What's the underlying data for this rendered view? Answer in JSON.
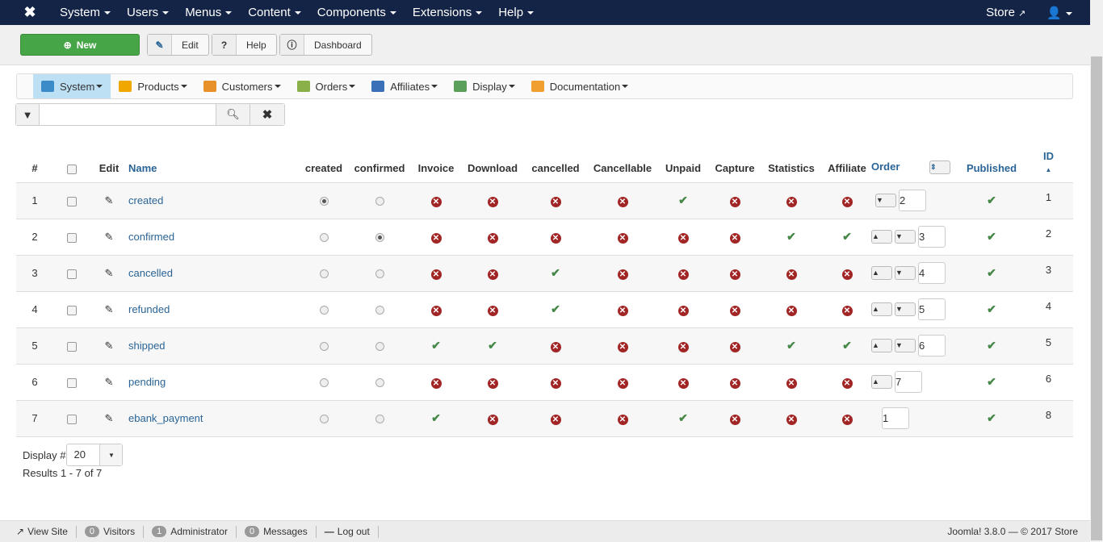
{
  "topnav": {
    "items": [
      "System",
      "Users",
      "Menus",
      "Content",
      "Components",
      "Extensions",
      "Help"
    ],
    "store": "Store"
  },
  "toolbar": {
    "new": "New",
    "edit": "Edit",
    "help": "Help",
    "dashboard": "Dashboard"
  },
  "submenu": [
    {
      "label": "System",
      "color": "#3b8bc9"
    },
    {
      "label": "Products",
      "color": "#f0a800"
    },
    {
      "label": "Customers",
      "color": "#e8902a"
    },
    {
      "label": "Orders",
      "color": "#8ab04a"
    },
    {
      "label": "Affiliates",
      "color": "#3a70b8"
    },
    {
      "label": "Display",
      "color": "#5aa05a"
    },
    {
      "label": "Documentation",
      "color": "#f0a030"
    }
  ],
  "search": {
    "value": "",
    "placeholder": ""
  },
  "table": {
    "headers": [
      "#",
      "Edit",
      "Name",
      "created",
      "confirmed",
      "Invoice",
      "Download",
      "cancelled",
      "Cancellable",
      "Unpaid",
      "Capture",
      "Statistics",
      "Affiliate",
      "Order",
      "Published",
      "ID"
    ],
    "rows": [
      {
        "num": "1",
        "name": "created",
        "radio": "created",
        "flags": [
          "x",
          "x",
          "x",
          "x",
          "v",
          "x",
          "x",
          "x"
        ],
        "up": false,
        "down": true,
        "order": "2",
        "published": "v",
        "id": "1"
      },
      {
        "num": "2",
        "name": "confirmed",
        "radio": "confirmed",
        "flags": [
          "x",
          "x",
          "x",
          "x",
          "x",
          "x",
          "v",
          "v"
        ],
        "up": true,
        "down": true,
        "order": "3",
        "published": "v",
        "id": "2"
      },
      {
        "num": "3",
        "name": "cancelled",
        "radio": "",
        "flags": [
          "x",
          "x",
          "v",
          "x",
          "x",
          "x",
          "x",
          "x"
        ],
        "up": true,
        "down": true,
        "order": "4",
        "published": "v",
        "id": "3"
      },
      {
        "num": "4",
        "name": "refunded",
        "radio": "",
        "flags": [
          "x",
          "x",
          "v",
          "x",
          "x",
          "x",
          "x",
          "x"
        ],
        "up": true,
        "down": true,
        "order": "5",
        "published": "v",
        "id": "4"
      },
      {
        "num": "5",
        "name": "shipped",
        "radio": "",
        "flags": [
          "v",
          "v",
          "x",
          "x",
          "x",
          "x",
          "v",
          "v"
        ],
        "up": true,
        "down": true,
        "order": "6",
        "published": "v",
        "id": "5"
      },
      {
        "num": "6",
        "name": "pending",
        "radio": "",
        "flags": [
          "x",
          "x",
          "x",
          "x",
          "x",
          "x",
          "x",
          "x"
        ],
        "up": true,
        "down": false,
        "order": "7",
        "published": "v",
        "id": "6"
      },
      {
        "num": "7",
        "name": "ebank_payment",
        "radio": "",
        "flags": [
          "v",
          "x",
          "x",
          "x",
          "v",
          "x",
          "x",
          "x"
        ],
        "up": false,
        "down": false,
        "order": "1",
        "published": "v",
        "id": "8"
      }
    ]
  },
  "pagination": {
    "display_label": "Display #",
    "display_value": "20",
    "results": "Results 1 - 7 of 7"
  },
  "footer": {
    "view_site": "View Site",
    "visitors_count": "0",
    "visitors": "Visitors",
    "admin_count": "1",
    "admin": "Administrator",
    "messages_count": "0",
    "messages": "Messages",
    "logout": "Log out",
    "copyright": "Joomla! 3.8.0  —  © 2017 Store"
  }
}
